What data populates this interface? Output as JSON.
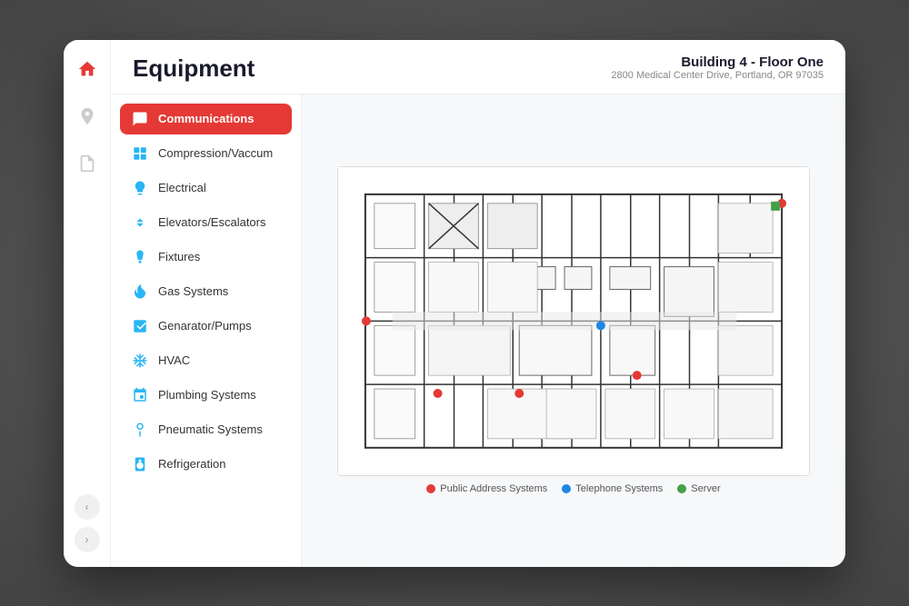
{
  "header": {
    "title": "Equipment",
    "building_name": "Building 4 - Floor One",
    "building_address": "2800 Medical Center Drive, Portland, OR 97035"
  },
  "nav": {
    "items": [
      {
        "name": "home",
        "icon": "home"
      },
      {
        "name": "location",
        "icon": "location"
      },
      {
        "name": "document",
        "icon": "document"
      }
    ],
    "prev_label": "‹",
    "next_label": "›"
  },
  "categories": [
    {
      "id": "communications",
      "label": "Communications",
      "icon": "comm",
      "active": true
    },
    {
      "id": "compression",
      "label": "Compression/Vaccum",
      "icon": "compress"
    },
    {
      "id": "electrical",
      "label": "Electrical",
      "icon": "electrical"
    },
    {
      "id": "elevators",
      "label": "Elevators/Escalators",
      "icon": "elevator"
    },
    {
      "id": "fixtures",
      "label": "Fixtures",
      "icon": "fixture"
    },
    {
      "id": "gas",
      "label": "Gas Systems",
      "icon": "gas"
    },
    {
      "id": "generator",
      "label": "Genarator/Pumps",
      "icon": "generator"
    },
    {
      "id": "hvac",
      "label": "HVAC",
      "icon": "hvac"
    },
    {
      "id": "plumbing",
      "label": "Plumbing Systems",
      "icon": "plumbing"
    },
    {
      "id": "pneumatic",
      "label": "Pneumatic Systems",
      "icon": "pneumatic"
    },
    {
      "id": "refrigeration",
      "label": "Refrigeration",
      "icon": "refrigeration"
    }
  ],
  "legend": [
    {
      "label": "Public Address Systems",
      "color": "#e53935"
    },
    {
      "label": "Telephone Systems",
      "color": "#1e88e5"
    },
    {
      "label": "Server",
      "color": "#43a047"
    }
  ]
}
